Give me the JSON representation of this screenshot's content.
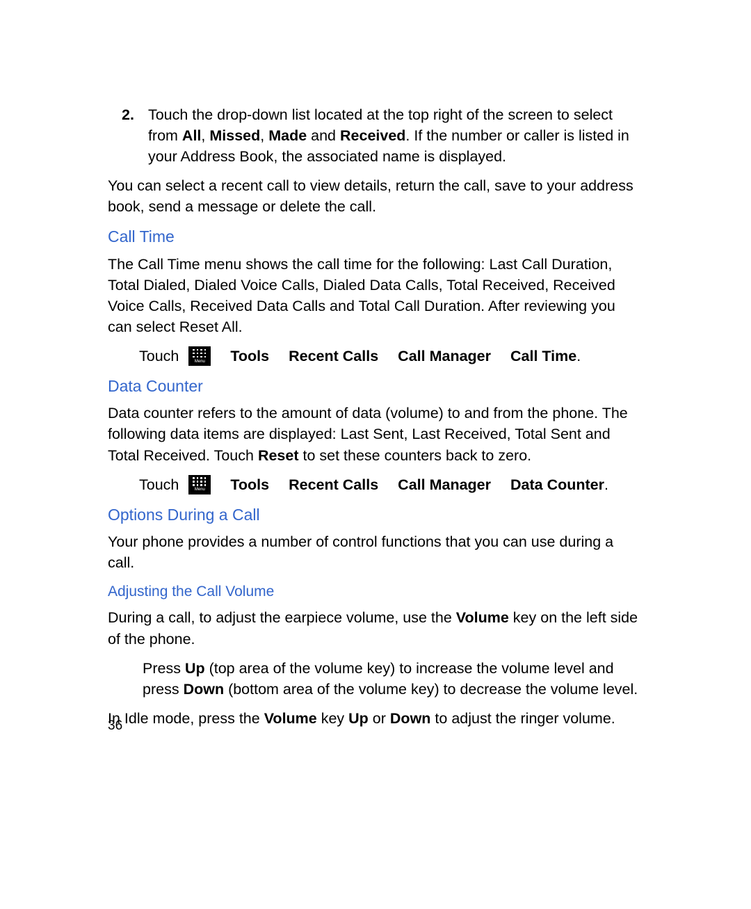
{
  "step2": {
    "num": "2.",
    "text_1": "Touch the drop-down list located at the top right of the screen to select from ",
    "bold_all": "All",
    "sep1": ", ",
    "bold_missed": "Missed",
    "sep2": ", ",
    "bold_made": "Made",
    "sep3": " and ",
    "bold_received": "Received",
    "text_2": ". If the number or caller is listed in your Address Book, the associated name is displayed."
  },
  "select_para": "You can select a recent call to view details, return the call, save to your address book, send a message or delete the call.",
  "call_time": {
    "heading": "Call Time",
    "desc": "The Call Time menu shows the call time for the following: Last Call Duration, Total Dialed, Dialed Voice Calls, Dialed Data Calls, Total Received, Received Voice Calls, Received Data Calls and Total Call Duration. After reviewing you can select Reset All.",
    "touch": "Touch",
    "menu_label": "Menu",
    "path": {
      "p1": "Tools",
      "p2": "Recent Calls",
      "p3": "Call Manager",
      "p4": "Call Time"
    },
    "period": "."
  },
  "data_counter": {
    "heading": "Data Counter",
    "desc_1": "Data counter refers to the amount of data (volume) to and from the phone. The following data items are displayed: Last Sent, Last Received, Total Sent and Total Received. Touch ",
    "bold_reset": "Reset",
    "desc_2": " to set these counters back to zero.",
    "touch": "Touch",
    "menu_label": "Menu",
    "path": {
      "p1": "Tools",
      "p2": "Recent Calls",
      "p3": "Call Manager",
      "p4": "Data Counter"
    },
    "period": "."
  },
  "options": {
    "heading": "Options During a Call",
    "desc": "Your phone provides a number of control functions that you can use during a call."
  },
  "volume": {
    "heading": "Adjusting the Call Volume",
    "desc_1": "During a call, to adjust the earpiece volume, use the ",
    "bold_volume1": "Volume",
    "desc_2": " key on the left side of the phone.",
    "press_1": "Press ",
    "bold_up": "Up",
    "press_2": " (top area of the volume key) to increase the volume level and press ",
    "bold_down": "Down",
    "press_3": " (bottom area of the volume key) to decrease the volume level.",
    "idle_1": "In Idle mode, press the ",
    "bold_volume2": "Volume",
    "idle_2": " key ",
    "bold_up2": "Up",
    "idle_3": " or ",
    "bold_down2": "Down",
    "idle_4": " to adjust the ringer volume."
  },
  "page_number": "36"
}
